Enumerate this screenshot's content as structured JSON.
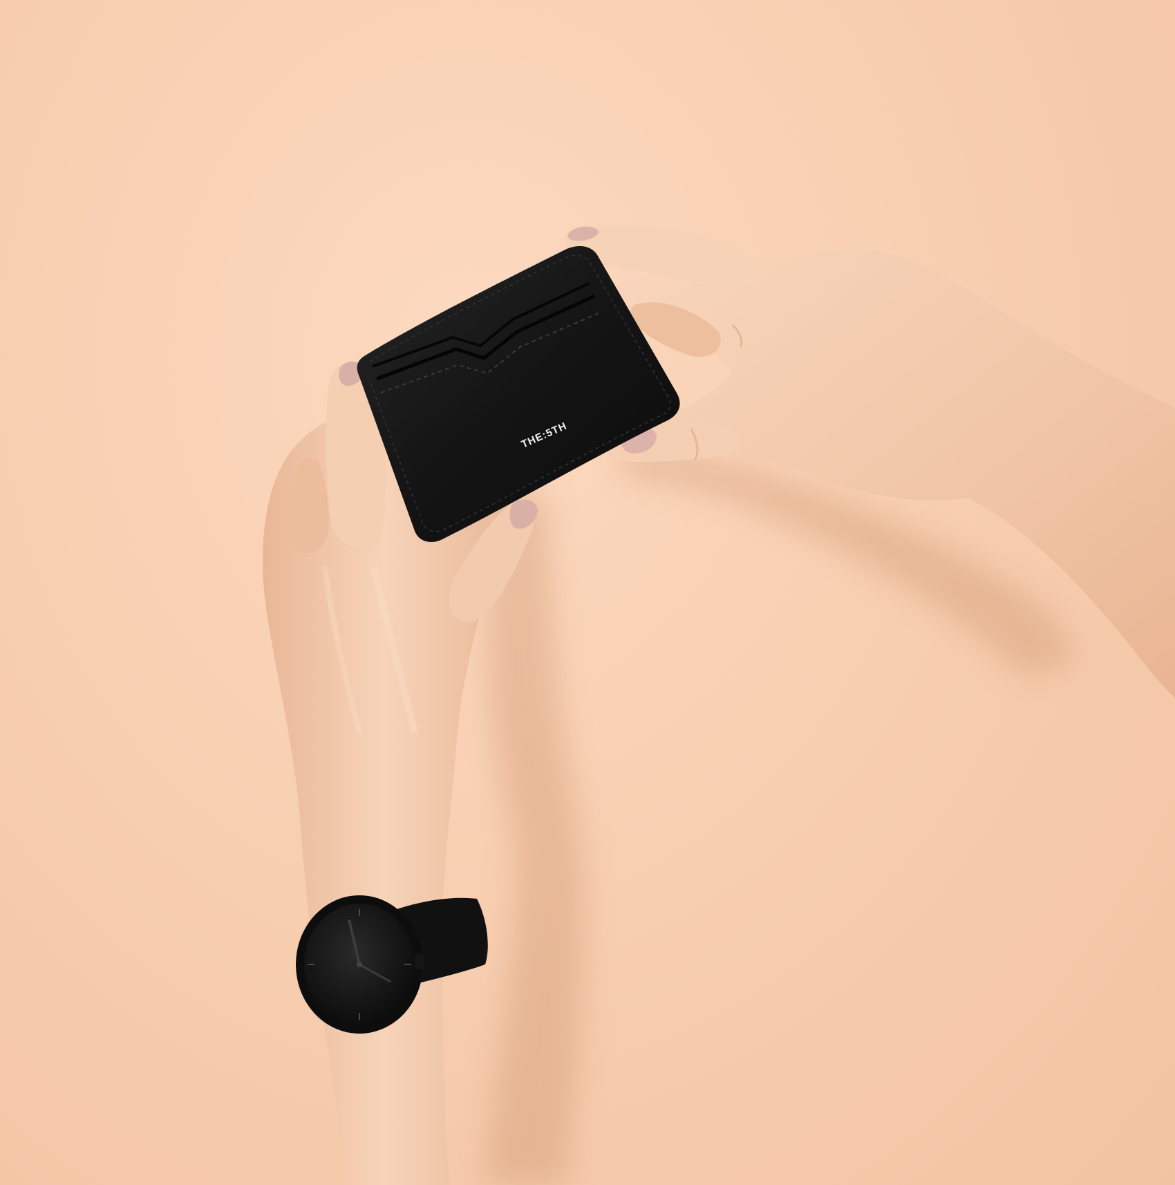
{
  "photo": {
    "background_color": "#f8d1b4",
    "card_holder": {
      "brand_imprint": "THE:5TH",
      "color": "#151515"
    },
    "watch": {
      "color": "#121212"
    },
    "skin_color": "#f3c9aa",
    "nail_color": "#d8aea8"
  }
}
